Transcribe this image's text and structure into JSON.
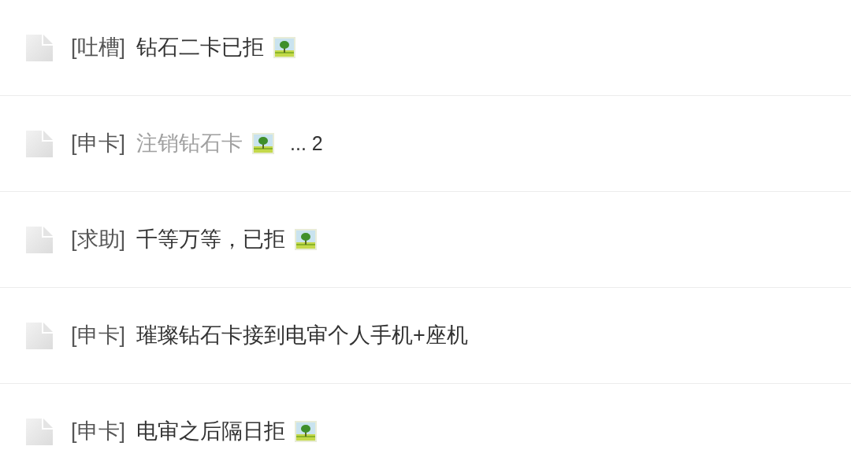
{
  "threads": [
    {
      "category": "[吐槽]",
      "title": "钻石二卡已拒",
      "visited": false,
      "has_image": true
    },
    {
      "category": "[申卡]",
      "title": "注销钻石卡",
      "visited": true,
      "has_image": true,
      "page_link": "... 2"
    },
    {
      "category": "[求助]",
      "title": "千等万等，已拒",
      "visited": false,
      "has_image": true
    },
    {
      "category": "[申卡]",
      "title": "璀璨钻石卡接到电审个人手机+座机",
      "visited": false,
      "has_image": false
    },
    {
      "category": "[申卡]",
      "title": "电审之后隔日拒",
      "visited": false,
      "has_image": true
    }
  ]
}
